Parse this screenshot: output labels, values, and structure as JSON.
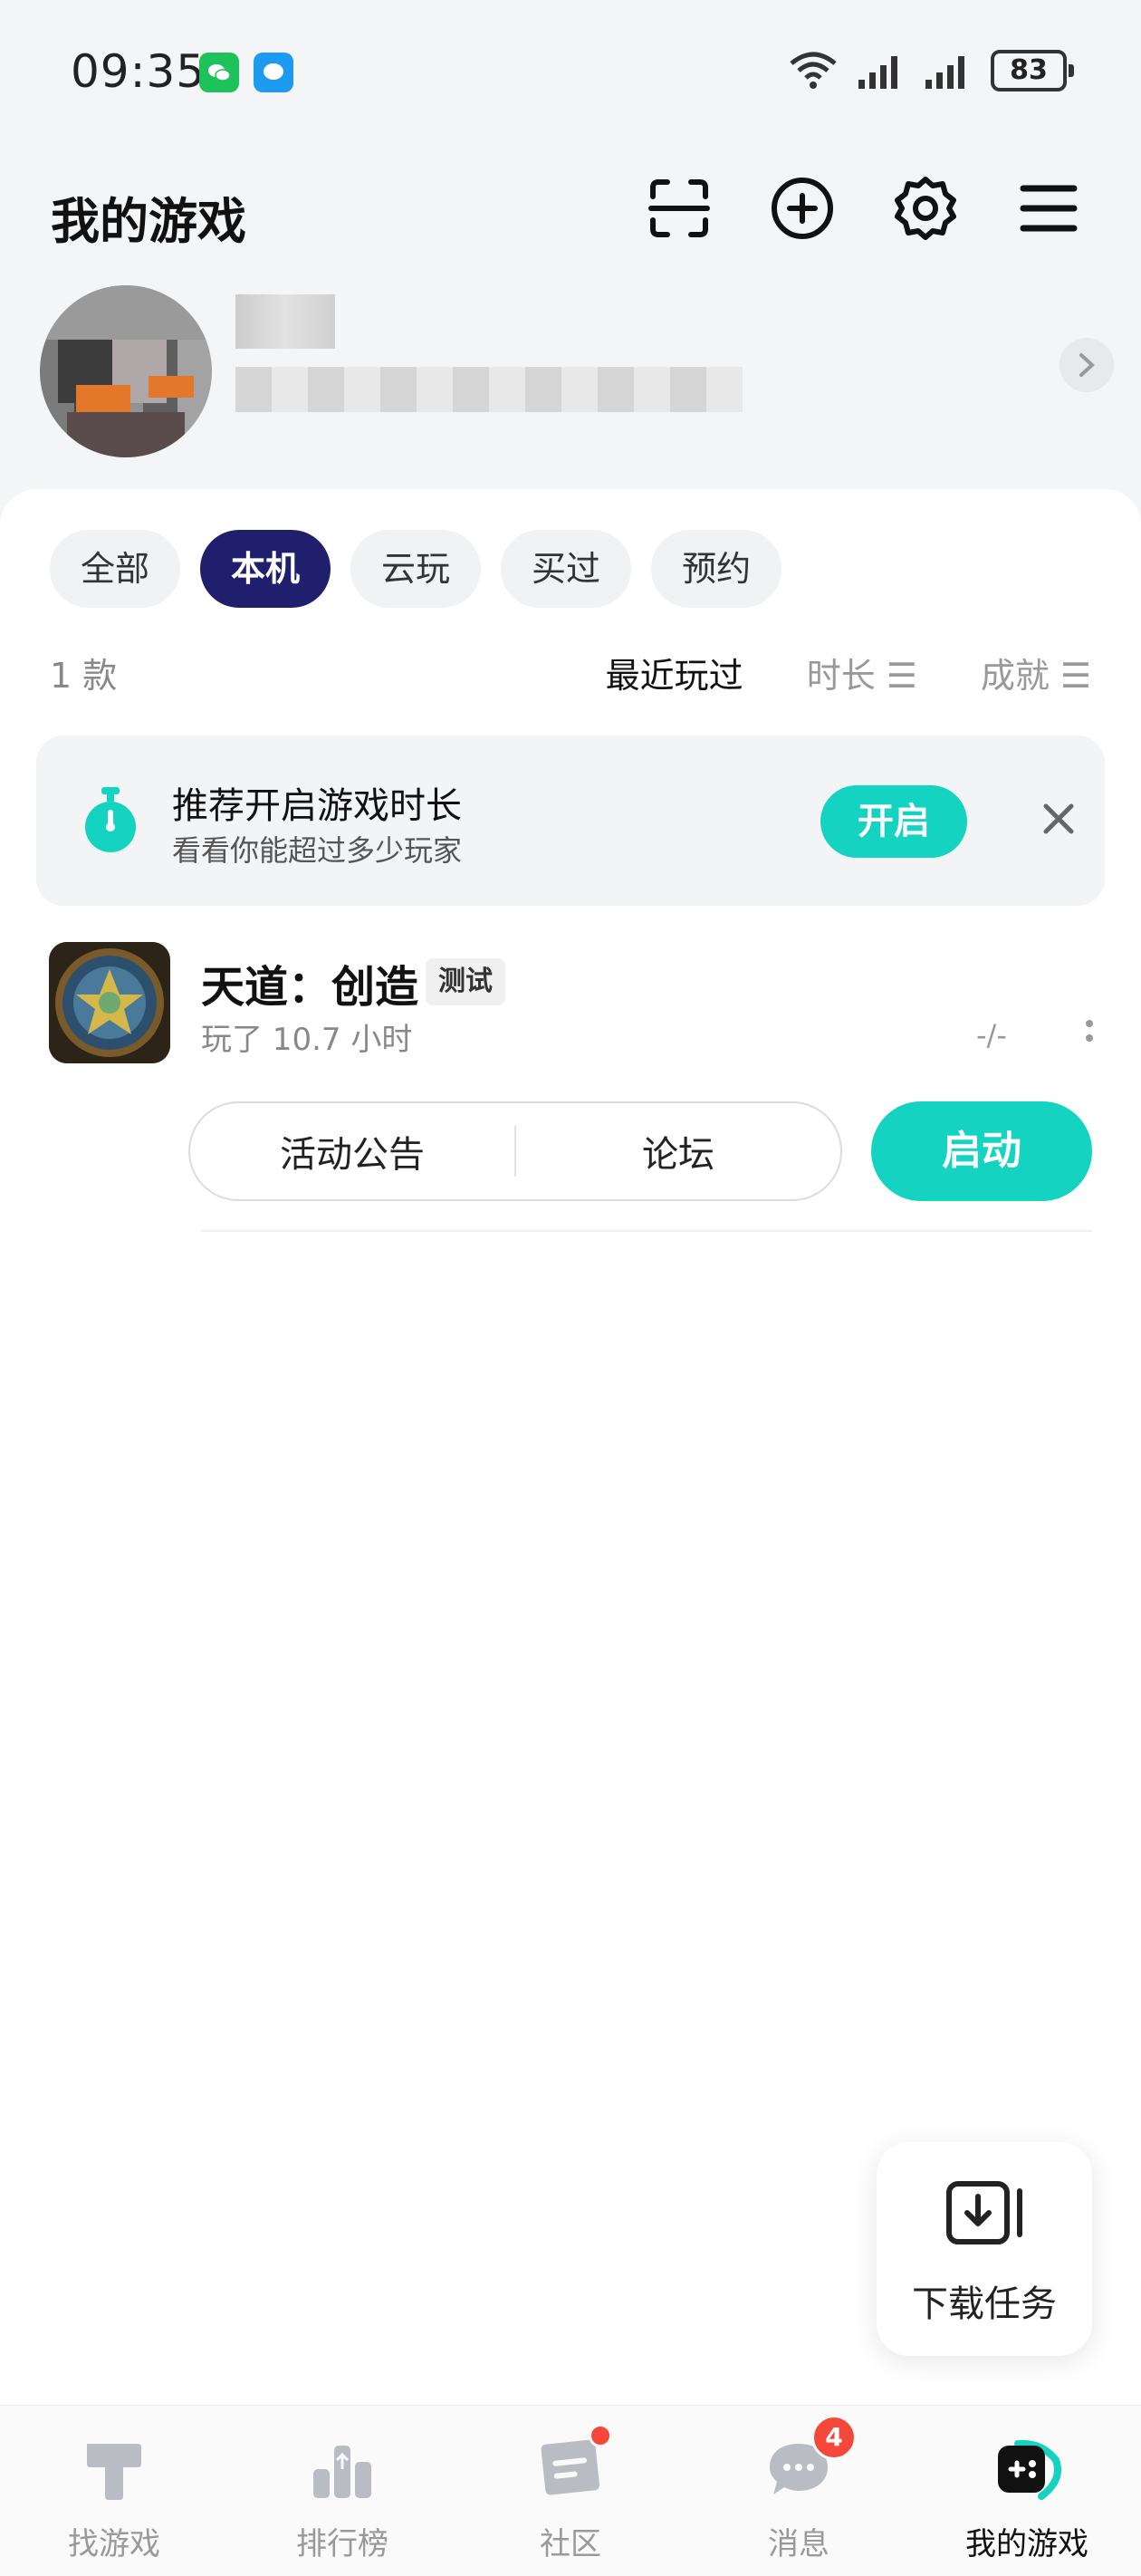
{
  "status_bar": {
    "time": "09:35",
    "battery": "83",
    "icons": [
      "wechat-icon",
      "message-icon",
      "wifi-icon",
      "signal-icon",
      "signal-icon",
      "battery-icon"
    ]
  },
  "header": {
    "title": "我的游戏",
    "icons": [
      "scan-icon",
      "add-circle-icon",
      "settings-icon",
      "menu-icon"
    ]
  },
  "filters": {
    "tabs": [
      "全部",
      "本机",
      "云玩",
      "买过",
      "预约"
    ],
    "active_tab": "本机",
    "count": "1 款",
    "sorts": [
      "最近玩过",
      "时长 ☰",
      "成就 ☰"
    ],
    "active_sort": "最近玩过"
  },
  "banner": {
    "title": "推荐开启游戏时长",
    "subtitle": "看看你能超过多少玩家",
    "button": "开启"
  },
  "games": [
    {
      "name": "天道：创造",
      "tag": "测试",
      "played": "玩了 10.7 小时",
      "rank": "-/-",
      "actions": [
        "活动公告",
        "论坛"
      ],
      "launch": "启动"
    }
  ],
  "download_float": {
    "label": "下载任务"
  },
  "bottom_nav": {
    "items": [
      "找游戏",
      "排行榜",
      "社区",
      "消息",
      "我的游戏"
    ],
    "active": "我的游戏",
    "message_badge": "4"
  },
  "colors": {
    "accent": "#14d3c0",
    "active_tab": "#1f1f6e",
    "badge": "#f5483b"
  }
}
